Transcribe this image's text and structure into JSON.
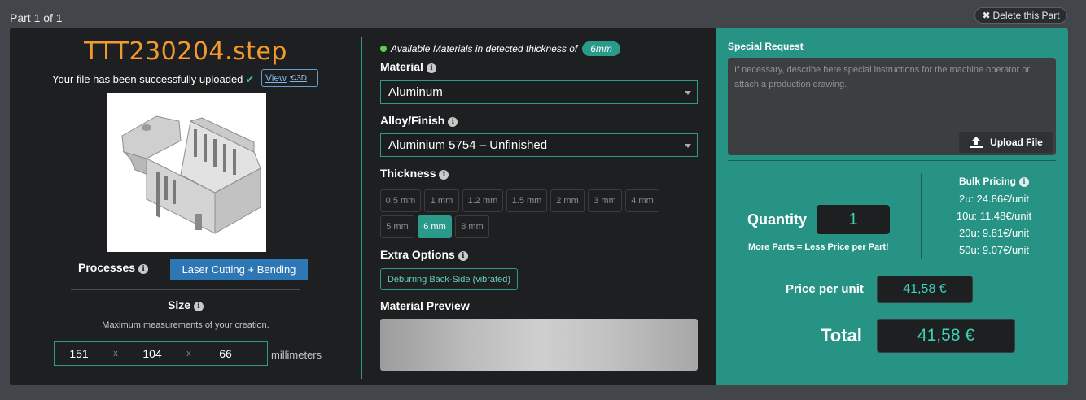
{
  "header": {
    "part_label": "Part 1 of 1",
    "delete_label": "Delete this Part"
  },
  "file": {
    "name": "TTT230204.step",
    "upload_message": "Your file has been successfully uploaded",
    "view_label": "View",
    "view_badge": "3D"
  },
  "processes": {
    "label": "Processes",
    "button": "Laser Cutting + Bending"
  },
  "size": {
    "label": "Size",
    "description": "Maximum measurements of your creation.",
    "x": "151",
    "y": "104",
    "z": "66",
    "separator": "x",
    "unit": "millimeters"
  },
  "availability": {
    "text": "Available Materials in detected thickness of",
    "pill": "6mm"
  },
  "material": {
    "label": "Material",
    "value": "Aluminum"
  },
  "alloy": {
    "label": "Alloy/Finish",
    "value": "Aluminium 5754 – Unfinished"
  },
  "thickness": {
    "label": "Thickness",
    "options": [
      "0.5 mm",
      "1 mm",
      "1.2 mm",
      "1.5 mm",
      "2 mm",
      "3 mm",
      "4 mm",
      "5 mm",
      "6 mm",
      "8 mm"
    ],
    "selected": "6 mm"
  },
  "extra": {
    "label": "Extra Options",
    "option": "Deburring Back-Side (vibrated)"
  },
  "material_preview": {
    "label": "Material Preview"
  },
  "special_request": {
    "label": "Special Request",
    "placeholder": "If necessary, describe here special instructions for the machine operator or attach a production drawing.",
    "upload_label": "Upload File"
  },
  "quantity": {
    "label": "Quantity",
    "value": "1",
    "note": "More Parts = Less Price per Part!"
  },
  "bulk_pricing": {
    "title": "Bulk Pricing",
    "rows": [
      "2u: 24.86€/unit",
      "10u: 11.48€/unit",
      "20u: 9.81€/unit",
      "50u: 9.07€/unit"
    ]
  },
  "pricing": {
    "price_per_unit_label": "Price per unit",
    "price_per_unit": "41,58 €",
    "total_label": "Total",
    "total": "41,58 €"
  },
  "colors": {
    "accent": "#279384",
    "filename": "#f39a2e",
    "button_blue": "#2d77b5",
    "value_teal": "#3fd1b8"
  }
}
